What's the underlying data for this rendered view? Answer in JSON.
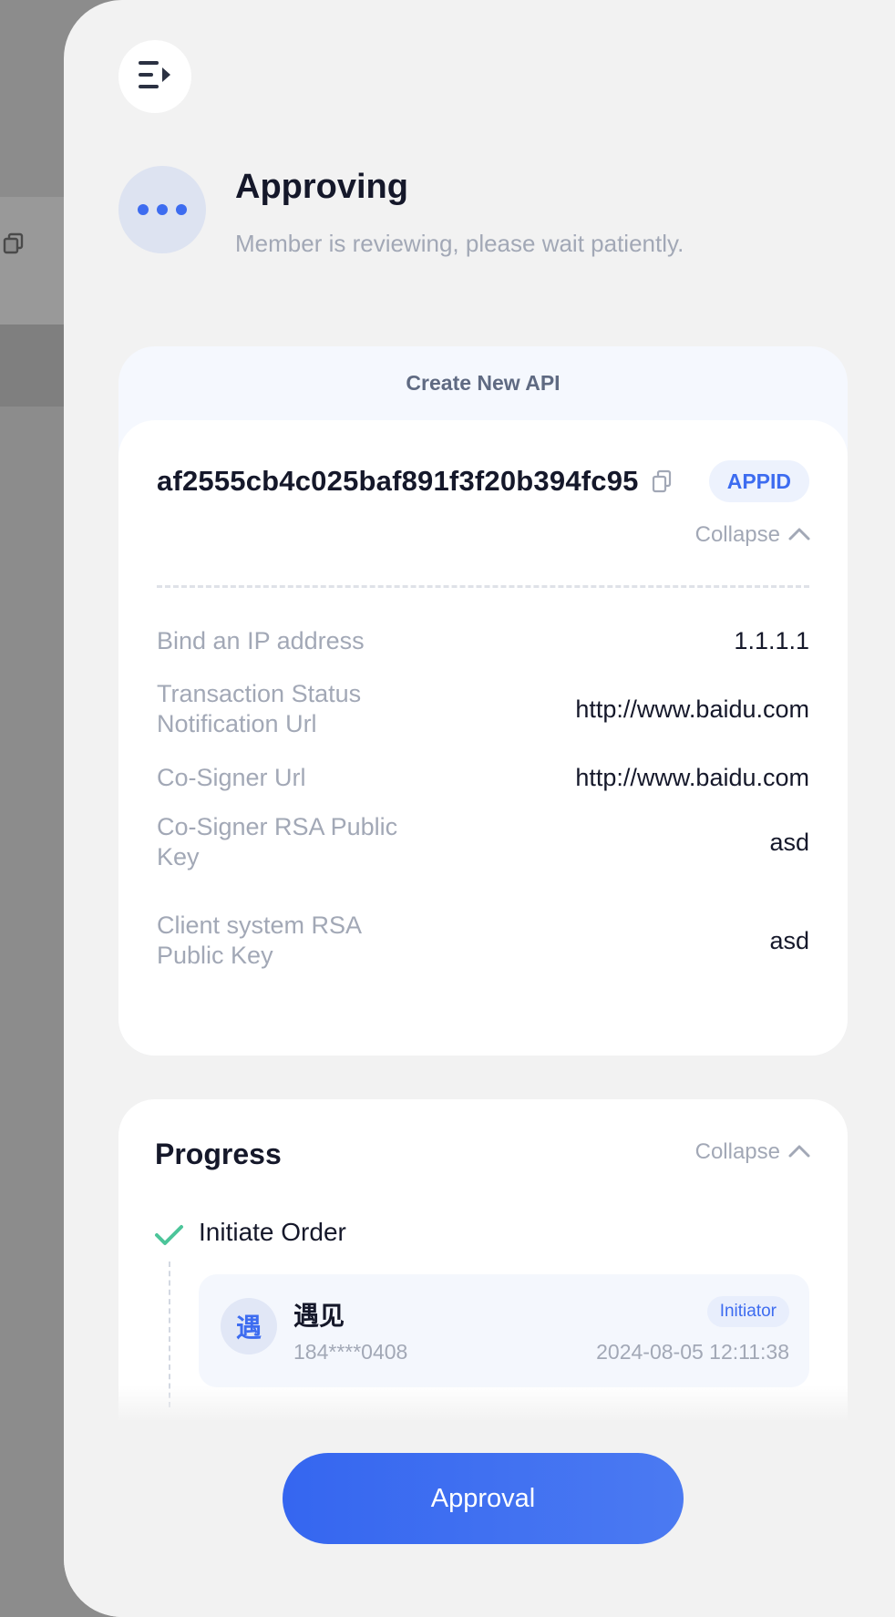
{
  "status": {
    "title": "Approving",
    "subtitle": "Member is reviewing, please wait patiently."
  },
  "api_card": {
    "header": "Create New API",
    "app_id": "af2555cb4c025baf891f3f20b394fc95",
    "app_id_badge": "APPID",
    "collapse_label": "Collapse",
    "fields": [
      {
        "label": "Bind an IP address",
        "value": "1.1.1.1"
      },
      {
        "label": "Transaction Status Notification Url",
        "value": "http://www.baidu.com"
      },
      {
        "label": "Co-Signer Url",
        "value": "http://www.baidu.com"
      },
      {
        "label": "Co-Signer RSA Public Key",
        "value": "asd"
      },
      {
        "label": "Client system RSA Public Key",
        "value": "asd"
      }
    ]
  },
  "progress": {
    "title": "Progress",
    "collapse_label": "Collapse",
    "steps": [
      {
        "label": "Initiate Order",
        "member": {
          "avatar": "遇",
          "name": "遇见",
          "phone": "184****0408",
          "role": "Initiator",
          "time": "2024-08-05 12:11:38"
        }
      }
    ]
  },
  "footer": {
    "approval_label": "Approval"
  },
  "colors": {
    "accent": "#3d6cf0",
    "success": "#4cc59a",
    "muted_text": "#a2a8b6",
    "primary_text": "#15182a"
  },
  "icons": [
    "menu-collapse-icon",
    "dots-icon",
    "copy-icon",
    "chevron-up-icon",
    "check-icon"
  ]
}
